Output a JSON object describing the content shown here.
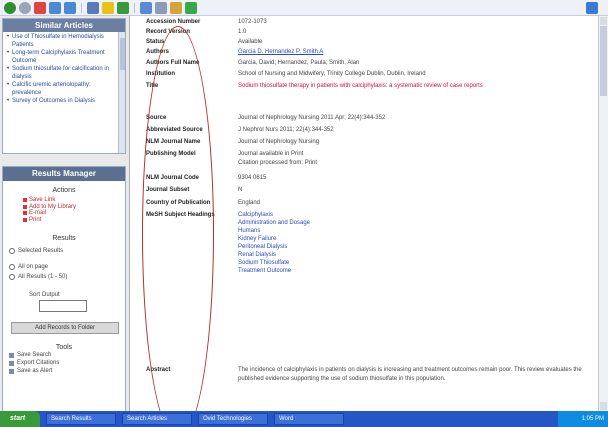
{
  "similar_articles": {
    "title": "Similar Articles",
    "items": [
      "Use of Thiosulfate in Hemodialysis Patients",
      "Long-term Calciphylaxis Treatment Outcome",
      "Sodium thiosulfate for calcification in dialysis",
      "Calcific uremic arteriolopathy: prevalence",
      "Survey of Outcomes in Dialysis"
    ]
  },
  "results_manager": {
    "title": "Results Manager",
    "actions_title": "Actions",
    "actions": [
      "Save Link",
      "Add to My Library",
      "E-mail",
      "Print"
    ],
    "results_title": "Results",
    "results_options": [
      "Selected Results",
      "All on page",
      "All Results (1 - 50)"
    ],
    "sort_label": "Sort Output",
    "add_button": "Add Records to Folder",
    "tools_title": "Tools",
    "tools": [
      "Save Search",
      "Export Citations",
      "Save as Alert"
    ]
  },
  "record": {
    "fields": [
      {
        "label": "Accession Number",
        "value": "1072-1073"
      },
      {
        "label": "Record Version",
        "value": "1.0"
      },
      {
        "label": "Status",
        "value": "Available"
      },
      {
        "label": "Authors",
        "value": "Garcia D, Hernandez P, Smith A"
      },
      {
        "label": "Authors Full Name",
        "value": "Garcia, David; Hernandez, Paula; Smith, Alan"
      },
      {
        "label": "Institution",
        "value": "School of Nursing and Midwifery, Trinity College Dublin, Dublin, Ireland"
      },
      {
        "label": "Title",
        "value": "Sodium thiosulfate therapy in patients with calciphylaxis: a systematic review of case reports"
      },
      {
        "label": "Source",
        "value": "Journal of Nephrology Nursing 2011 Apr; 22(4):344-352"
      },
      {
        "label": "Abbreviated Source",
        "value": "J Nephrol Nurs 2011; 22(4):344-352"
      },
      {
        "label": "NLM Journal Name",
        "value": "Journal of Nephrology Nursing"
      },
      {
        "label": "Publishing Model",
        "value": "Journal available in Print\nCitation processed from: Print"
      },
      {
        "label": "NLM Journal Code",
        "value": "9304 0615"
      },
      {
        "label": "Journal Subset",
        "value": "N"
      },
      {
        "label": "Country of Publication",
        "value": "England"
      },
      {
        "label": "MeSH Subject Headings",
        "value": "Calciphylaxis\nAdministration and Dosage\nHumans\nKidney Failure\nPeritoneal Dialysis\nRenal Dialysis\nSodium Thiosulfate\nTreatment Outcome"
      },
      {
        "label": "Abstract",
        "value": "The incidence of calciphylaxis in patients on dialysis is increasing and treatment outcomes remain poor. This review evaluates the published evidence supporting the use of sodium thiosulfate in this population."
      }
    ]
  },
  "taskbar": {
    "start": "start",
    "tasks": [
      "Search Results",
      "Search Articles",
      "Ovid Technologies",
      "Word"
    ],
    "clock": "1:05 PM"
  }
}
